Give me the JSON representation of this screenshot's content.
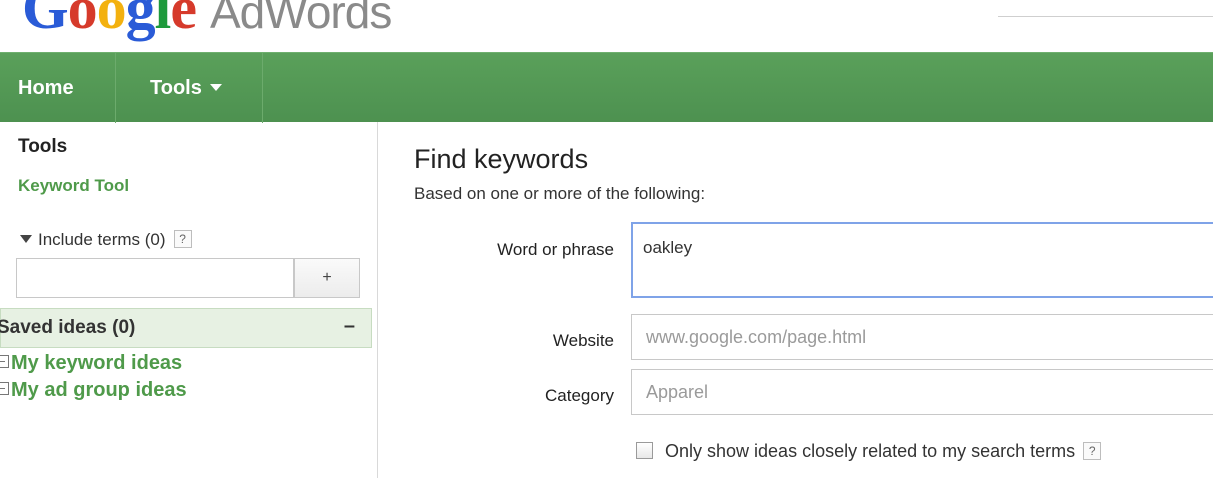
{
  "logo": {
    "brand_letters": [
      "G",
      "o",
      "o",
      "g",
      "l",
      "e"
    ],
    "product": "AdWords"
  },
  "nav": {
    "home": "Home",
    "tools": "Tools"
  },
  "sidebar": {
    "heading": "Tools",
    "link": "Keyword Tool",
    "include_label": "Include terms (0)",
    "help": "?",
    "add_button": "+",
    "saved_title": "Saved ideas (0)",
    "collapse": "–",
    "saved_items": [
      "My keyword ideas",
      "My ad group ideas"
    ]
  },
  "main": {
    "title": "Find keywords",
    "subtitle": "Based on one or more of the following:",
    "word_label": "Word or phrase",
    "word_value": "oakley",
    "website_label": "Website",
    "website_placeholder": "www.google.com/page.html",
    "category_label": "Category",
    "category_placeholder": "Apparel",
    "checkbox_label": "Only show ideas closely related to my search terms",
    "help": "?"
  },
  "colors": {
    "nav_green": "#4d9150",
    "link_green": "#4f9a4a",
    "focus_blue": "#7fa3e8"
  }
}
